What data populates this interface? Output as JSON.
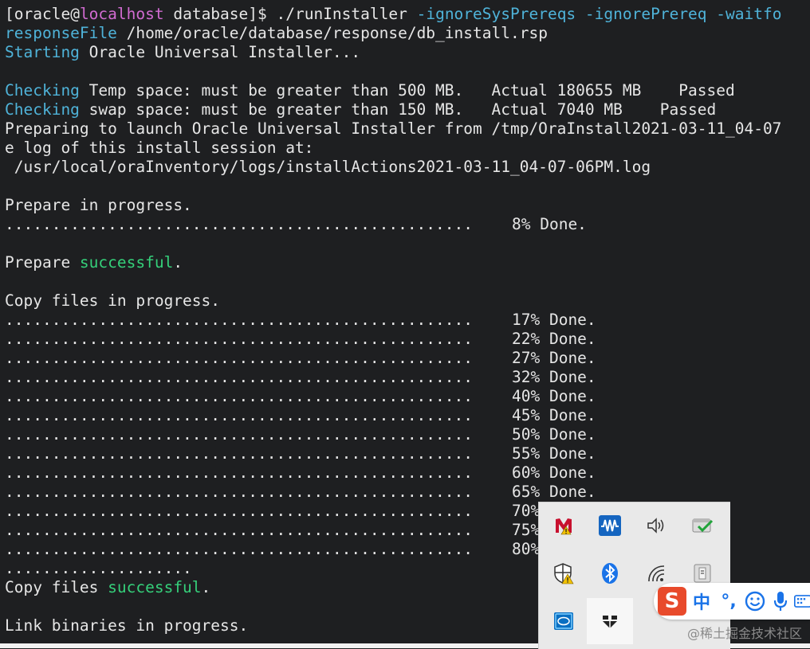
{
  "terminal": {
    "prompt_open": "[",
    "prompt_user": "oracle@",
    "prompt_host": "localhost",
    "prompt_rest": " database]$ ./runInstaller ",
    "cmd_flags": "-ignoreSysPrereqs -ignorePrereq -waitfo",
    "line2_flag": "responseFile",
    "line2_rest": " /home/oracle/database/response/db_install.rsp",
    "line3_cyan": "Starting",
    "line3_rest": " Oracle Universal Installer...",
    "check1_cyan": "Checking",
    "check1_rest": " Temp space: must be greater than 500 MB.   Actual 180655 MB    Passed",
    "check2_cyan": "Checking",
    "check2_rest": " swap space: must be greater than 150 MB.   Actual 7040 MB    Passed",
    "preparing_line": "Preparing to launch Oracle Universal Installer from /tmp/OraInstall2021-03-11_04-07",
    "log_line": "e log of this install session at:",
    "log_path": " /usr/local/oraInventory/logs/installActions2021-03-11_04-07-06PM.log",
    "prepare_progress": "Prepare in progress.",
    "dots": "..................................................",
    "prepare_pct": "8% Done.",
    "prepare_succ_a": "Prepare ",
    "prepare_succ_b": "successful",
    "prepare_succ_c": ".",
    "copy_progress": "Copy files in progress.",
    "copy_pcts": [
      "17% Done.",
      "22% Done.",
      "27% Done.",
      "32% Done.",
      "40% Done.",
      "45% Done.",
      "50% Done.",
      "55% Done.",
      "60% Done.",
      "65% Done.",
      "70%",
      "75%",
      "80%"
    ],
    "short_dots": "....................",
    "copy_succ_a": "Copy files ",
    "copy_succ_b": "successful",
    "copy_succ_c": ".",
    "link_progress": "Link binaries in progress."
  },
  "tray": {
    "icons": [
      "mcafee-warning-icon",
      "waves-audio-icon",
      "volume-icon",
      "security-check-icon",
      "defender-warning-icon",
      "bluetooth-icon",
      "wifi-icon",
      "usb-eject-icon",
      "intel-graphics-icon",
      "app-icon"
    ]
  },
  "ime": {
    "logo": "S",
    "lang": "中",
    "punct": "°,"
  },
  "watermark": "@稀土掘金技术社区",
  "colors": {
    "background": "#1e1f21",
    "text": "#e6e6e6",
    "host": "#d16bd1",
    "cyan": "#4fb3d9",
    "green": "#35d07a"
  }
}
